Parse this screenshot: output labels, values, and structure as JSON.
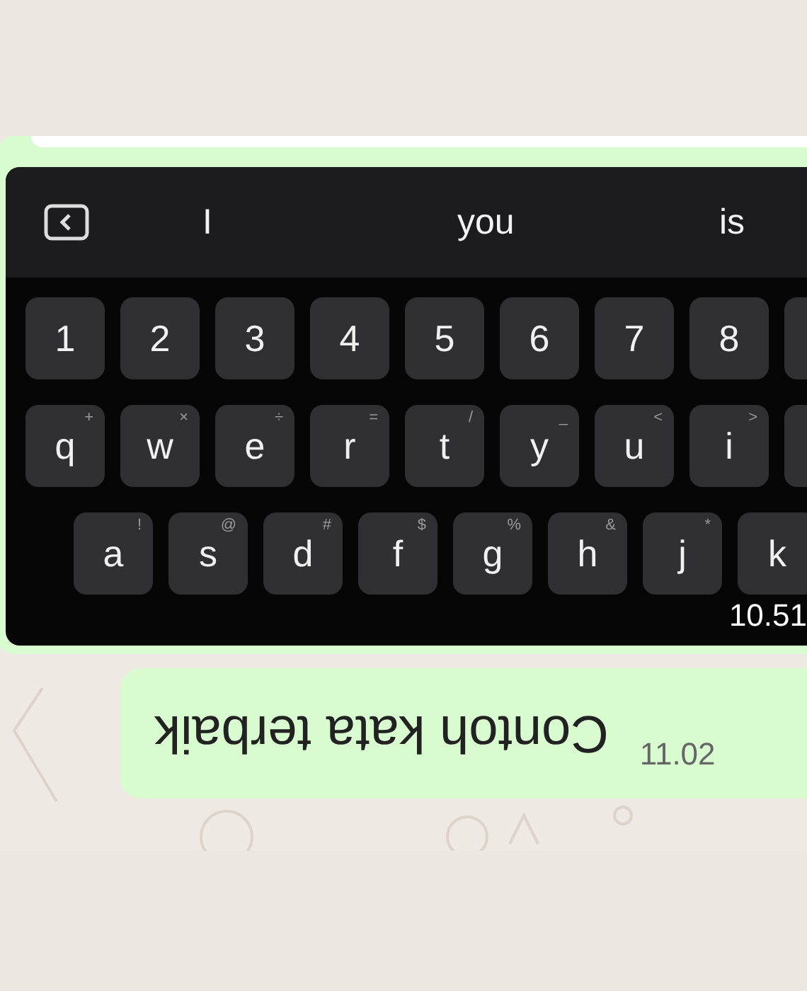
{
  "messages": [
    {
      "kind": "keyboard-image",
      "suggestions": [
        "I",
        "you",
        "is"
      ],
      "rows": [
        {
          "offset": false,
          "keys": [
            {
              "label": "1"
            },
            {
              "label": "2"
            },
            {
              "label": "3"
            },
            {
              "label": "4"
            },
            {
              "label": "5"
            },
            {
              "label": "6"
            },
            {
              "label": "7"
            },
            {
              "label": "8"
            }
          ]
        },
        {
          "offset": false,
          "keys": [
            {
              "label": "q",
              "hint": "+"
            },
            {
              "label": "w",
              "hint": "×"
            },
            {
              "label": "e",
              "hint": "÷"
            },
            {
              "label": "r",
              "hint": "="
            },
            {
              "label": "t",
              "hint": "/"
            },
            {
              "label": "y",
              "hint": "_"
            },
            {
              "label": "u",
              "hint": "<"
            },
            {
              "label": "i",
              "hint": ">"
            }
          ]
        },
        {
          "offset": true,
          "keys": [
            {
              "label": "a",
              "hint": "!"
            },
            {
              "label": "s",
              "hint": "@"
            },
            {
              "label": "d",
              "hint": "#"
            },
            {
              "label": "f",
              "hint": "$"
            },
            {
              "label": "g",
              "hint": "%"
            },
            {
              "label": "h",
              "hint": "&"
            },
            {
              "label": "j",
              "hint": "*"
            },
            {
              "label": "k"
            }
          ]
        }
      ],
      "time": "10.51"
    },
    {
      "kind": "text",
      "text": "Contoh kata terbaik",
      "flipped": true,
      "time": "11.02"
    }
  ]
}
